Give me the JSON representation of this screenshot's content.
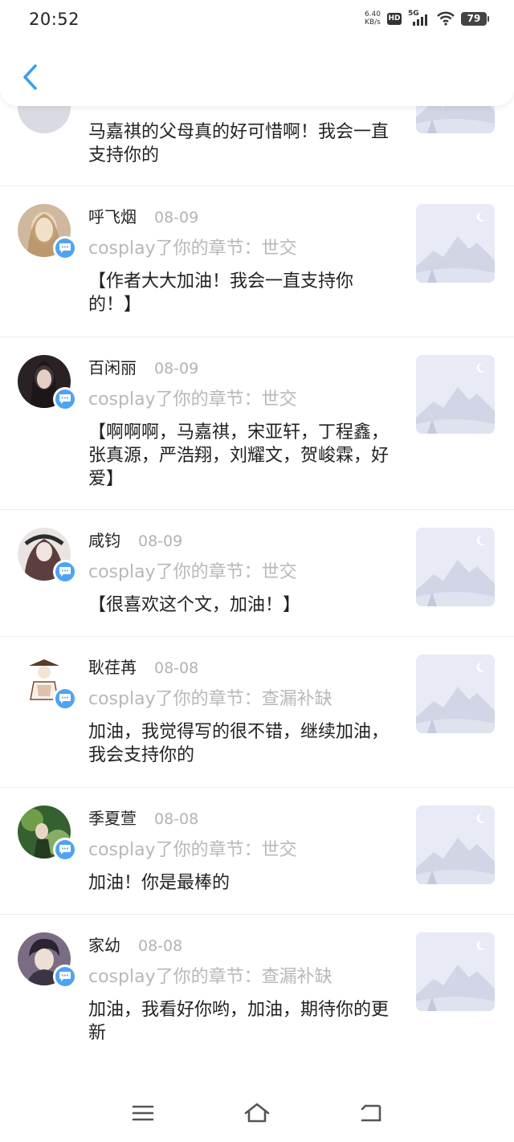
{
  "status_bar": {
    "time": "20:52",
    "net_speed_value": "6.40",
    "net_speed_unit": "KB/s",
    "hd": "HD",
    "network": "5G",
    "battery": "79"
  },
  "header": {
    "back_icon": "chevron-left-icon",
    "accent_color": "#3a9ff0"
  },
  "comments": [
    {
      "name": "",
      "date": "",
      "action": "",
      "text": "马嘉祺的父母真的好可惜啊！我会一直支持你的",
      "avatar_color": "#4fa3f2"
    },
    {
      "name": "呼飞烟",
      "date": "08-09",
      "action": "cosplay了你的章节：世交",
      "text": "【作者大大加油！我会一直支持你的！】",
      "avatar_color": "#c9a98a"
    },
    {
      "name": "百闲丽",
      "date": "08-09",
      "action": "cosplay了你的章节：世交",
      "text": "【啊啊啊，马嘉祺，宋亚轩，丁程鑫，张真源，严浩翔，刘耀文，贺峻霖，好爱】",
      "avatar_color": "#2b2326"
    },
    {
      "name": "咸钧",
      "date": "08-09",
      "action": "cosplay了你的章节：世交",
      "text": "【很喜欢这个文，加油！】",
      "avatar_color": "#6e5a55"
    },
    {
      "name": "耿荏苒",
      "date": "08-08",
      "action": "cosplay了你的章节：查漏补缺",
      "text": "加油，我觉得写的很不错，继续加油，我会支持你的",
      "avatar_color": "#f4efe8"
    },
    {
      "name": "季夏萱",
      "date": "08-08",
      "action": "cosplay了你的章节：世交",
      "text": "加油！你是最棒的",
      "avatar_color": "#3f6b3a"
    },
    {
      "name": "家幼",
      "date": "08-08",
      "action": "cosplay了你的章节：查漏补缺",
      "text": "加油，我看好你哟，加油，期待你的更新",
      "avatar_color": "#5b4f63"
    }
  ],
  "nav_bar": {
    "menu_icon": "menu-icon",
    "home_icon": "home-icon",
    "back_icon": "back-icon"
  }
}
